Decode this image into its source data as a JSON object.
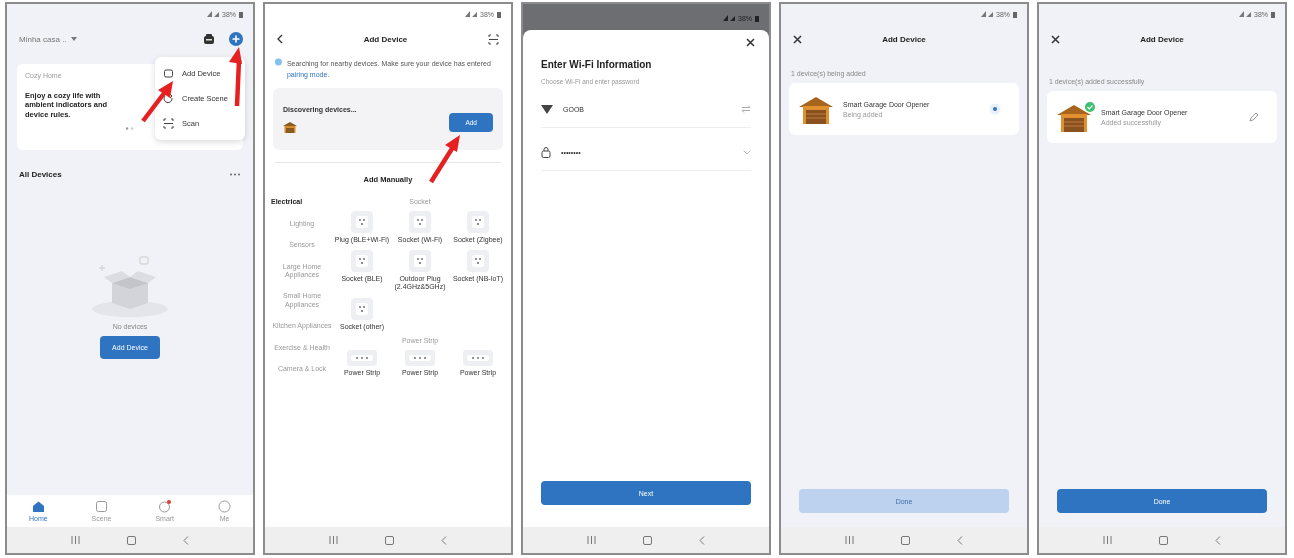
{
  "home": {
    "status": "38%",
    "home_name": "Minha casa ..",
    "menu": [
      {
        "label": "Add Device"
      },
      {
        "label": "Create Scene"
      },
      {
        "label": "Scan"
      }
    ],
    "banner": {
      "caption": "Cozy Home",
      "text": "Enjoy a cozy life with ambient indicators and device rules."
    },
    "section_title": "All Devices",
    "empty_text": "No devices",
    "add_button": "Add Device",
    "tabs": [
      {
        "label": "Home",
        "selected": true,
        "badge": false
      },
      {
        "label": "Scene",
        "selected": false,
        "badge": false
      },
      {
        "label": "Smart",
        "selected": false,
        "badge": true
      },
      {
        "label": "Me",
        "selected": false,
        "badge": false
      }
    ]
  },
  "add_device": {
    "status": "38%",
    "title": "Add Device",
    "notice": "Searching for nearby devices. Make sure your device has entered",
    "notice_link": "pairing mode.",
    "discover_text": "Discovering devices...",
    "add_button": "Add",
    "manual_title": "Add Manually",
    "categories": [
      {
        "label": "Electrical",
        "selected": true
      },
      {
        "label": "Lighting",
        "selected": false
      },
      {
        "label": "Sensors",
        "selected": false
      },
      {
        "label": "Large Home Appliances",
        "selected": false
      },
      {
        "label": "Small Home Appliances",
        "selected": false
      },
      {
        "label": "Kitchen Appliances",
        "selected": false
      },
      {
        "label": "Exercise & Health",
        "selected": false
      },
      {
        "label": "Camera & Lock",
        "selected": false
      }
    ],
    "groups": [
      {
        "title": "Socket",
        "items": [
          {
            "label": "Plug (BLE+Wi-Fi)",
            "kind": "socket"
          },
          {
            "label": "Socket (Wi-Fi)",
            "kind": "socket"
          },
          {
            "label": "Socket (Zigbee)",
            "kind": "socket"
          },
          {
            "label": "Socket (BLE)",
            "kind": "socket"
          },
          {
            "label": "Outdoor Plug (2.4GHz&5GHz)",
            "kind": "socket"
          },
          {
            "label": "Socket (NB-IoT)",
            "kind": "socket"
          },
          {
            "label": "Socket (other)",
            "kind": "socket"
          }
        ]
      },
      {
        "title": "Power Strip",
        "items": [
          {
            "label": "Power Strip",
            "kind": "strip"
          },
          {
            "label": "Power Strip",
            "kind": "strip"
          },
          {
            "label": "Power Strip",
            "kind": "strip"
          }
        ]
      }
    ]
  },
  "wifi": {
    "status": "38%",
    "title": "Enter Wi-Fi Information",
    "subtitle": "Choose Wi-Fi and enter password",
    "network": "GOOB",
    "password": "••••••••",
    "next_button": "Next"
  },
  "adding": {
    "status": "38%",
    "title": "Add Device",
    "caption": "1 device(s) being added",
    "device": {
      "name": "Smart Garage Door Opener",
      "status": "Being added",
      "added": false
    },
    "button": {
      "label": "Done",
      "disabled": true
    }
  },
  "done": {
    "status": "38%",
    "title": "Add Device",
    "caption": "1 device(s) added successfully",
    "device": {
      "name": "Smart Garage Door Opener",
      "status": "Added successfully",
      "added": true
    },
    "button": {
      "label": "Done",
      "disabled": false
    }
  }
}
